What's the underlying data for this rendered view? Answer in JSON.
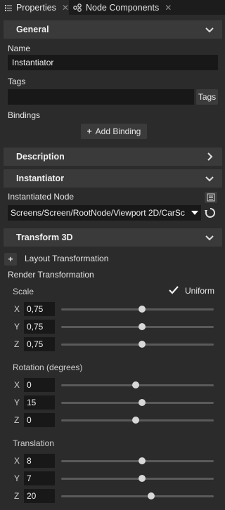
{
  "tabs": [
    {
      "label": "Properties",
      "icon": "list-icon",
      "active": true
    },
    {
      "label": "Node Components",
      "icon": "components-icon",
      "active": false
    }
  ],
  "general": {
    "title": "General",
    "name_label": "Name",
    "name_value": "Instantiator",
    "tags_label": "Tags",
    "tags_value": "",
    "tags_button": "Tags",
    "bindings_label": "Bindings",
    "add_binding_label": "Add Binding"
  },
  "description": {
    "title": "Description"
  },
  "instantiator": {
    "title": "Instantiator",
    "node_label": "Instantiated Node",
    "node_value": "Screens/Screen/RootNode/Viewport 2D/CarSc"
  },
  "transform": {
    "title": "Transform 3D",
    "layout_label": "Layout Transformation",
    "render_label": "Render Transformation",
    "scale": {
      "label": "Scale",
      "uniform_label": "Uniform",
      "uniform_checked": true,
      "rows": [
        {
          "axis": "X",
          "value": "0,75",
          "slider": 0.53
        },
        {
          "axis": "Y",
          "value": "0,75",
          "slider": 0.53
        },
        {
          "axis": "Z",
          "value": "0,75",
          "slider": 0.53
        }
      ]
    },
    "rotation": {
      "label": "Rotation (degrees)",
      "rows": [
        {
          "axis": "X",
          "value": "0",
          "slider": 0.49
        },
        {
          "axis": "Y",
          "value": "15",
          "slider": 0.53
        },
        {
          "axis": "Z",
          "value": "0",
          "slider": 0.49
        }
      ]
    },
    "translation": {
      "label": "Translation",
      "rows": [
        {
          "axis": "X",
          "value": "8",
          "slider": 0.53
        },
        {
          "axis": "Y",
          "value": "7",
          "slider": 0.53
        },
        {
          "axis": "Z",
          "value": "20",
          "slider": 0.59
        }
      ]
    }
  }
}
